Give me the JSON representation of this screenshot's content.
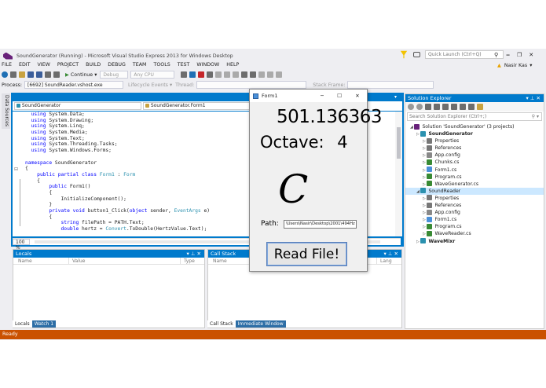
{
  "window": {
    "title": "SoundGenerator (Running) - Microsoft Visual Studio Express 2013 for Windows Desktop",
    "quick_launch": "Quick Launch (Ctrl+Q)",
    "user": "Nasir Kas"
  },
  "menu": [
    "FILE",
    "EDIT",
    "VIEW",
    "PROJECT",
    "BUILD",
    "DEBUG",
    "TEAM",
    "TOOLS",
    "TEST",
    "WINDOW",
    "HELP"
  ],
  "toolbar": {
    "continue": "Continue",
    "config": "Debug",
    "platform": "Any CPU",
    "process_label": "Process:",
    "process_value": "[6692] SoundReader.vshost.exe",
    "lifecycle": "Lifecycle Events",
    "thread": "Thread:",
    "stack_frame": "Stack Frame:"
  },
  "side_tabs": [
    "Data Sources"
  ],
  "editor": {
    "class_combo": "SoundGenerator",
    "member_combo": "SoundGenerator.Form1",
    "zoom": "100 %",
    "lines": [
      [
        [
          "  using ",
          "kw"
        ],
        [
          "System.Data;",
          ""
        ]
      ],
      [
        [
          "  using ",
          "kw"
        ],
        [
          "System.Drawing;",
          ""
        ]
      ],
      [
        [
          "  using ",
          "kw"
        ],
        [
          "System.Linq;",
          ""
        ]
      ],
      [
        [
          "  using ",
          "kw"
        ],
        [
          "System.Media;",
          ""
        ]
      ],
      [
        [
          "  using ",
          "kw"
        ],
        [
          "System.Text;",
          ""
        ]
      ],
      [
        [
          "  using ",
          "kw"
        ],
        [
          "System.Threading.Tasks;",
          ""
        ]
      ],
      [
        [
          "  using ",
          "kw"
        ],
        [
          "System.Windows.Forms;",
          ""
        ]
      ],
      [
        [
          "",
          ""
        ]
      ],
      [
        [
          "namespace ",
          "kw"
        ],
        [
          "SoundGenerator",
          ""
        ]
      ],
      [
        [
          "{",
          ""
        ]
      ],
      [
        [
          "    public partial class ",
          "kw"
        ],
        [
          "Form1",
          "ty"
        ],
        [
          " : ",
          ""
        ],
        [
          "Form",
          "ty"
        ]
      ],
      [
        [
          "    {",
          ""
        ]
      ],
      [
        [
          "        public ",
          "kw"
        ],
        [
          "Form1()",
          ""
        ]
      ],
      [
        [
          "        {",
          ""
        ]
      ],
      [
        [
          "            InitializeComponent();",
          ""
        ]
      ],
      [
        [
          "        }",
          ""
        ]
      ],
      [
        [
          "        private void ",
          "kw"
        ],
        [
          "button1_Click(",
          ""
        ],
        [
          "object ",
          "kw"
        ],
        [
          "sender, ",
          ""
        ],
        [
          "EventArgs ",
          "ty"
        ],
        [
          "e)",
          ""
        ]
      ],
      [
        [
          "        {",
          ""
        ]
      ],
      [
        [
          "            string ",
          "kw"
        ],
        [
          "filePath = PATH.Text;",
          ""
        ]
      ],
      [
        [
          "            double ",
          "kw"
        ],
        [
          "hertz = ",
          ""
        ],
        [
          "Convert",
          "ty"
        ],
        [
          ".ToDouble(HertzValue.Text);",
          ""
        ]
      ]
    ]
  },
  "locals": {
    "title": "Locals",
    "cols": [
      "Name",
      "Value",
      "Type"
    ],
    "tabs": [
      "Locals",
      "Watch 1"
    ]
  },
  "callstack": {
    "title": "Call Stack",
    "cols": [
      "Name",
      "Lang"
    ],
    "tabs": [
      "Call Stack",
      "Immediate Window"
    ]
  },
  "solution": {
    "title": "Solution Explorer",
    "search": "Search Solution Explorer (Ctrl+;)",
    "items": [
      {
        "d": 0,
        "t": "Solution 'SoundGenerator' (3 projects)",
        "i": "sln"
      },
      {
        "d": 1,
        "t": "SoundGenerator",
        "i": "cs",
        "b": true
      },
      {
        "d": 2,
        "t": "Properties",
        "i": "prop"
      },
      {
        "d": 2,
        "t": "References",
        "i": "ref"
      },
      {
        "d": 2,
        "t": "App.config",
        "i": "cfg"
      },
      {
        "d": 2,
        "t": "Chunks.cs",
        "i": "csf"
      },
      {
        "d": 2,
        "t": "Form1.cs",
        "i": "form"
      },
      {
        "d": 2,
        "t": "Program.cs",
        "i": "csf"
      },
      {
        "d": 2,
        "t": "WaveGenerator.cs",
        "i": "csf"
      },
      {
        "d": 1,
        "t": "SoundReader",
        "i": "cs",
        "sel": true
      },
      {
        "d": 2,
        "t": "Properties",
        "i": "prop"
      },
      {
        "d": 2,
        "t": "References",
        "i": "ref"
      },
      {
        "d": 2,
        "t": "App.config",
        "i": "cfg"
      },
      {
        "d": 2,
        "t": "Form1.cs",
        "i": "form"
      },
      {
        "d": 2,
        "t": "Program.cs",
        "i": "csf"
      },
      {
        "d": 2,
        "t": "WaveReader.cs",
        "i": "csf"
      },
      {
        "d": 1,
        "t": "WaveMixr",
        "i": "cs",
        "b": true
      }
    ]
  },
  "status": "Ready",
  "form1": {
    "title": "Form1",
    "frequency": "501.136363",
    "octave_label": "Octave:",
    "octave_value": "4",
    "note": "C",
    "path_label": "Path:",
    "path_value": "\\Users\\Nasir\\Desktop\\2001\\494Hz",
    "button": "Read File!"
  },
  "colors": {
    "accent": "#007acc",
    "status_bar": "#ca5100",
    "keyword": "#0000ff",
    "type": "#2b91af"
  }
}
